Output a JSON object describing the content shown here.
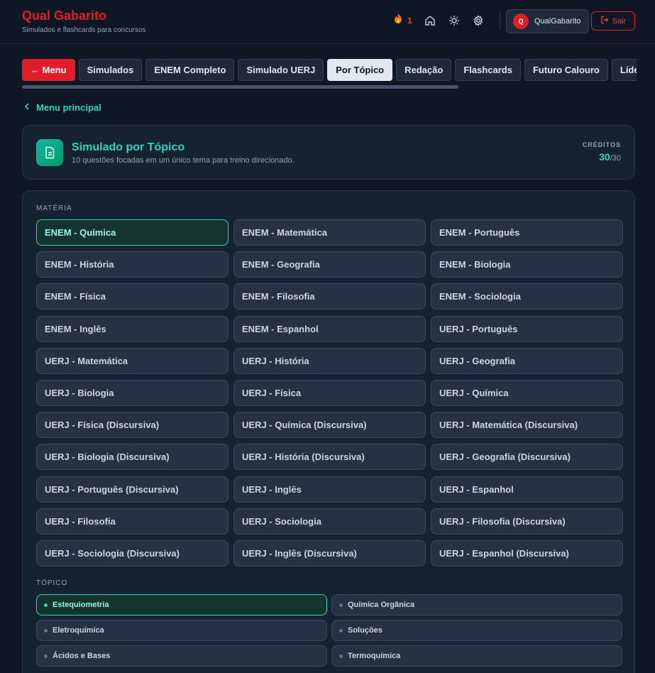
{
  "header": {
    "brand_title": "Qual Gabarito",
    "brand_subtitle": "Simulados e flashcards para concursos",
    "streak_count": "1",
    "user_initial": "Q",
    "user_name": "QualGabarito",
    "logout_label": "Sair"
  },
  "tabs": [
    "← Menu",
    "Simulados",
    "ENEM Completo",
    "Simulado UERJ",
    "Por Tópico",
    "Redação",
    "Flashcards",
    "Futuro Calouro",
    "Líderes"
  ],
  "active_tab": "Por Tópico",
  "back_link": "Menu principal",
  "info": {
    "title": "Simulado por Tópico",
    "description": "10 questões focadas em um único tema para treino direcionado.",
    "credits_label": "CRÉDITOS",
    "credits_current": "30",
    "credits_max": "/30"
  },
  "subject_label": "MATÉRIA",
  "subjects": [
    "ENEM - Química",
    "ENEM - Matemática",
    "ENEM - Português",
    "ENEM - História",
    "ENEM - Geografia",
    "ENEM - Biologia",
    "ENEM - Física",
    "ENEM - Filosofia",
    "ENEM - Sociologia",
    "ENEM - Inglês",
    "ENEM - Espanhol",
    "UERJ - Português",
    "UERJ - Matemática",
    "UERJ - História",
    "UERJ - Geografia",
    "UERJ - Biologia",
    "UERJ - Física",
    "UERJ - Química",
    "UERJ - Física (Discursiva)",
    "UERJ - Química (Discursiva)",
    "UERJ - Matemática (Discursiva)",
    "UERJ - Biologia (Discursiva)",
    "UERJ - História (Discursiva)",
    "UERJ - Geografia (Discursiva)",
    "UERJ - Português (Discursiva)",
    "UERJ - Inglês",
    "UERJ - Espanhol",
    "UERJ - Filosofia",
    "UERJ - Sociologia",
    "UERJ - Filosofia (Discursiva)",
    "UERJ - Sociologia (Discursiva)",
    "UERJ - Inglês (Discursiva)",
    "UERJ - Espanhol (Discursiva)"
  ],
  "active_subject": "ENEM - Química",
  "topic_label": "TÓPICO",
  "topics": [
    "Estequiometria",
    "Química Orgânica",
    "Eletroquímica",
    "Soluções",
    "Ácidos e Bases",
    "Termoquímica"
  ],
  "active_topic": "Estequiometria",
  "colors": {
    "brand": "#e11d2a",
    "accent": "#2dd4bf",
    "background": "#0f1724"
  }
}
